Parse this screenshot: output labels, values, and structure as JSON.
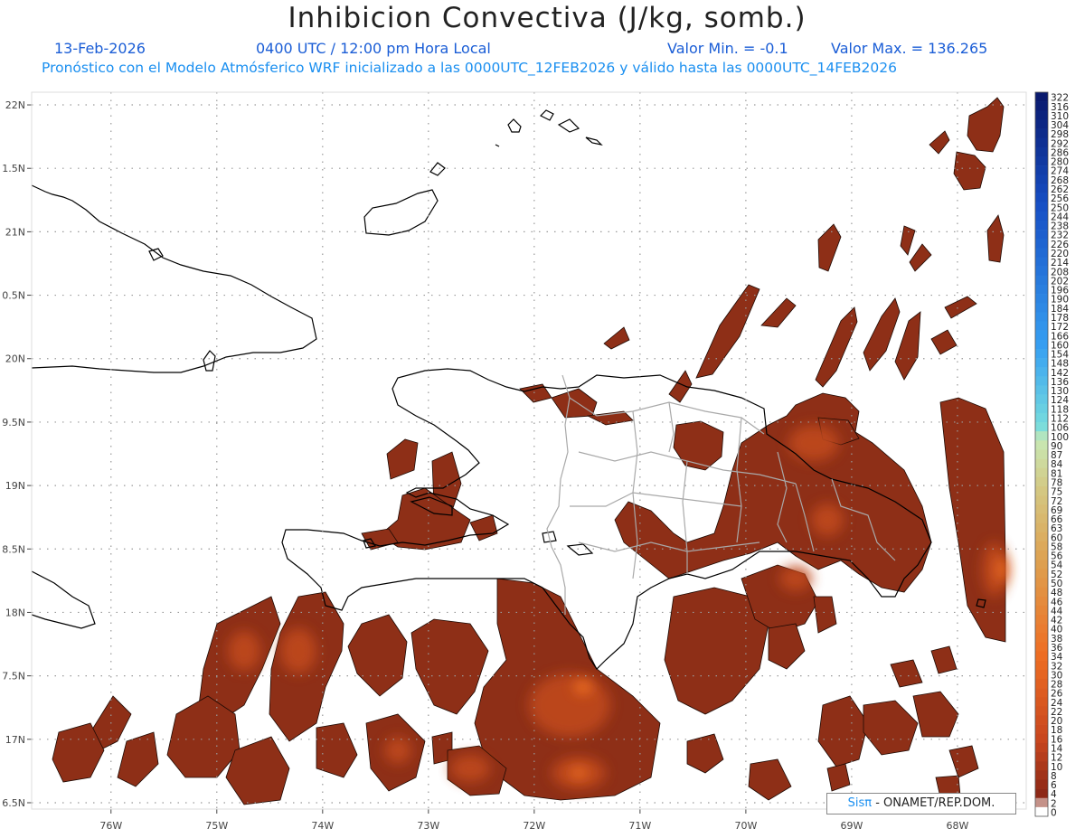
{
  "header": {
    "title": "Inhibicion Convectiva (J/kg, somb.)",
    "date": "13-Feb-2026",
    "time": "0400 UTC / 12:00 pm Hora Local",
    "value_min": "Valor Min. = -0.1",
    "value_max": "Valor Max. = 136.265",
    "forecast_note": "Pronóstico con el Modelo Atmósferico WRF inicializado a las 0000UTC_12FEB2026 y válido hasta las  0000UTC_14FEB2026"
  },
  "credit": {
    "sis": "Sisπ",
    "org": " - ONAMET/REP.DOM."
  },
  "map": {
    "lon_range": [
      -76.75,
      -67.35
    ],
    "lat_range": [
      16.45,
      22.1
    ],
    "lon_ticks": [
      {
        "value": -76,
        "label": "76W"
      },
      {
        "value": -75,
        "label": "75W"
      },
      {
        "value": -74,
        "label": "74W"
      },
      {
        "value": -73,
        "label": "73W"
      },
      {
        "value": -72,
        "label": "72W"
      },
      {
        "value": -71,
        "label": "71W"
      },
      {
        "value": -70,
        "label": "70W"
      },
      {
        "value": -69,
        "label": "69W"
      },
      {
        "value": -68,
        "label": "68W"
      }
    ],
    "lat_ticks": [
      {
        "value": 22,
        "label": "22N"
      },
      {
        "value": 21.5,
        "label": "1.5N"
      },
      {
        "value": 21,
        "label": "21N"
      },
      {
        "value": 20.5,
        "label": "0.5N"
      },
      {
        "value": 20,
        "label": "20N"
      },
      {
        "value": 19.5,
        "label": "9.5N"
      },
      {
        "value": 19,
        "label": "19N"
      },
      {
        "value": 18.5,
        "label": "8.5N"
      },
      {
        "value": 18,
        "label": "18N"
      },
      {
        "value": 17.5,
        "label": "7.5N"
      },
      {
        "value": 17,
        "label": "17N"
      },
      {
        "value": 16.5,
        "label": "6.5N"
      }
    ],
    "grid": true
  },
  "colorbar": {
    "labels": [
      "322",
      "316",
      "310",
      "304",
      "298",
      "292",
      "286",
      "280",
      "274",
      "268",
      "262",
      "256",
      "250",
      "244",
      "238",
      "232",
      "226",
      "220",
      "214",
      "208",
      "202",
      "196",
      "190",
      "184",
      "178",
      "172",
      "166",
      "160",
      "154",
      "148",
      "142",
      "136",
      "130",
      "124",
      "118",
      "112",
      "106",
      "100",
      "90",
      "87",
      "84",
      "81",
      "78",
      "75",
      "72",
      "69",
      "66",
      "63",
      "60",
      "58",
      "56",
      "54",
      "52",
      "50",
      "48",
      "46",
      "44",
      "42",
      "40",
      "38",
      "36",
      "34",
      "32",
      "30",
      "28",
      "26",
      "24",
      "22",
      "20",
      "18",
      "16",
      "14",
      "12",
      "10",
      "8",
      "6",
      "4",
      "2",
      "0"
    ]
  }
}
